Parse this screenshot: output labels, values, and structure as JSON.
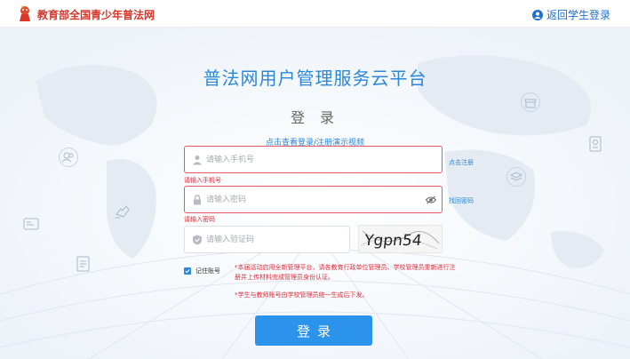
{
  "header": {
    "logo_icon": "mascot-logo-icon",
    "site_name": "教育部全国青少年普法网",
    "back_icon": "user-circle-icon",
    "back_label": "返回学生登录"
  },
  "main": {
    "platform_title": "普法网用户管理服务云平台",
    "login_heading": "登 录",
    "demo_link": "点击查看登录/注册演示视频"
  },
  "form": {
    "phone": {
      "icon": "user-icon",
      "placeholder": "请输入手机号",
      "value": "",
      "error": "请输入手机号",
      "side_link": "点击注册"
    },
    "password": {
      "icon": "lock-icon",
      "placeholder": "请输入密码",
      "value": "",
      "error": "请输入密码",
      "eye_icon": "eye-icon",
      "side_link": "找回密码"
    },
    "captcha": {
      "icon": "shield-check-icon",
      "placeholder": "请输入验证码",
      "value": "",
      "image_text": "Ygpn54"
    },
    "remember": {
      "label": "记住账号",
      "checked": true
    },
    "notice_1": "*本届活动启用全新管理平台，请各教育行政单位管理员、学校管理员重新进行注册并上传材料完成管理员身份认证。",
    "notice_2": "*学生与教师账号由学校管理员统一生成后下发。",
    "submit_label": "登录"
  },
  "colors": {
    "accent": "#2b88d8",
    "button": "#2b93ec",
    "error": "#e02d3c",
    "brand_red": "#d9362a"
  }
}
